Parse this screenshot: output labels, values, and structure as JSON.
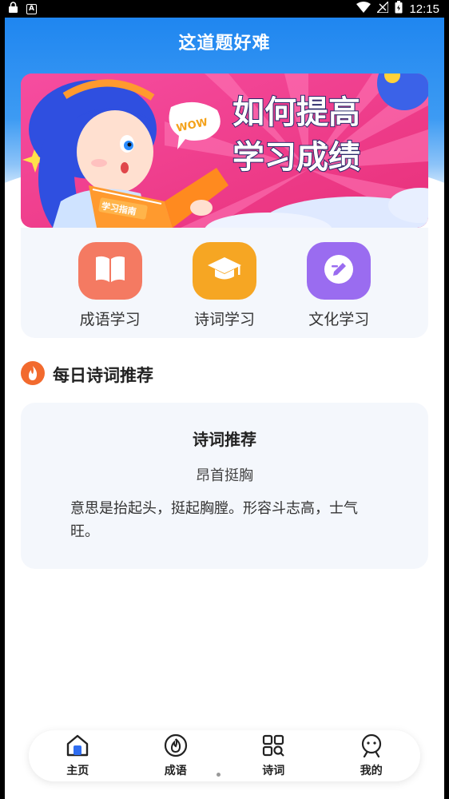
{
  "status_bar": {
    "time": "12:15"
  },
  "app": {
    "title": "这道题好难"
  },
  "banner": {
    "line1": "如何提高",
    "line2": "学习成绩",
    "bubble": "WOW",
    "book": "学习指南"
  },
  "categories": [
    {
      "label": "成语学习",
      "icon": "book-icon",
      "color": "#f47a62"
    },
    {
      "label": "诗词学习",
      "icon": "graduation-cap-icon",
      "color": "#f6a623"
    },
    {
      "label": "文化学习",
      "icon": "pencil-icon",
      "color": "#9a6cf0"
    }
  ],
  "section": {
    "title": "每日诗词推荐"
  },
  "poem": {
    "heading": "诗词推荐",
    "word": "昂首挺胸",
    "description": "意思是抬起头，挺起胸膛。形容斗志高，士气旺。"
  },
  "tabs": [
    {
      "label": "主页",
      "icon": "home-icon"
    },
    {
      "label": "成语",
      "icon": "fire-icon"
    },
    {
      "label": "诗词",
      "icon": "grid-search-icon"
    },
    {
      "label": "我的",
      "icon": "profile-icon"
    }
  ]
}
